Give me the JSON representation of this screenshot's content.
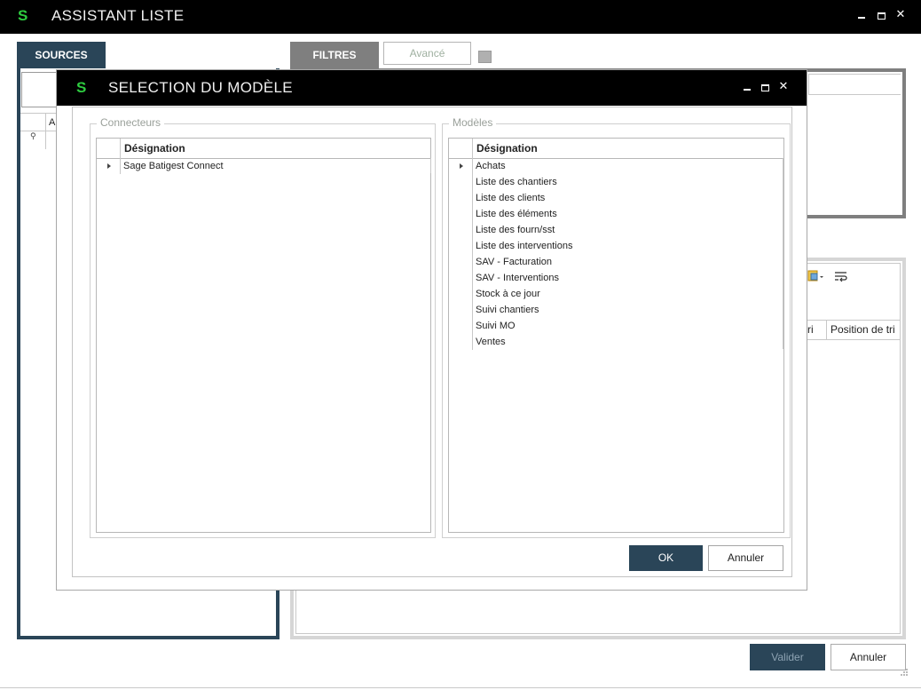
{
  "main_window": {
    "logo": "S",
    "title": "ASSISTANT LISTE",
    "tabs": {
      "sources": "SOURCES",
      "filtres": "FILTRES"
    },
    "avance_label": "Avancé",
    "sources_grid_header": "A",
    "pin_glyph": "⚲",
    "columns": [
      "ri",
      "Position de tri"
    ],
    "valider_label": "Valider",
    "annuler_label": "Annuler"
  },
  "dialog": {
    "logo": "S",
    "title": "SELECTION DU MODÈLE",
    "connecteurs": {
      "group_label": "Connecteurs",
      "column_header": "Désignation",
      "rows": [
        "Sage Batigest Connect"
      ]
    },
    "modeles": {
      "group_label": "Modèles",
      "column_header": "Désignation",
      "rows": [
        "Achats",
        "Liste des chantiers",
        "Liste des clients",
        "Liste des éléments",
        "Liste des fourn/sst",
        "Liste des interventions",
        "SAV - Facturation",
        "SAV - Interventions",
        "Stock à ce jour",
        "Suivi chantiers",
        "Suivi MO",
        "Ventes"
      ]
    },
    "ok_label": "OK",
    "annuler_label": "Annuler"
  },
  "colors": {
    "titlebar": "#000000",
    "logo_green": "#2ecc40",
    "navy": "#2a4558",
    "gray_tab": "#7f7f7f"
  }
}
